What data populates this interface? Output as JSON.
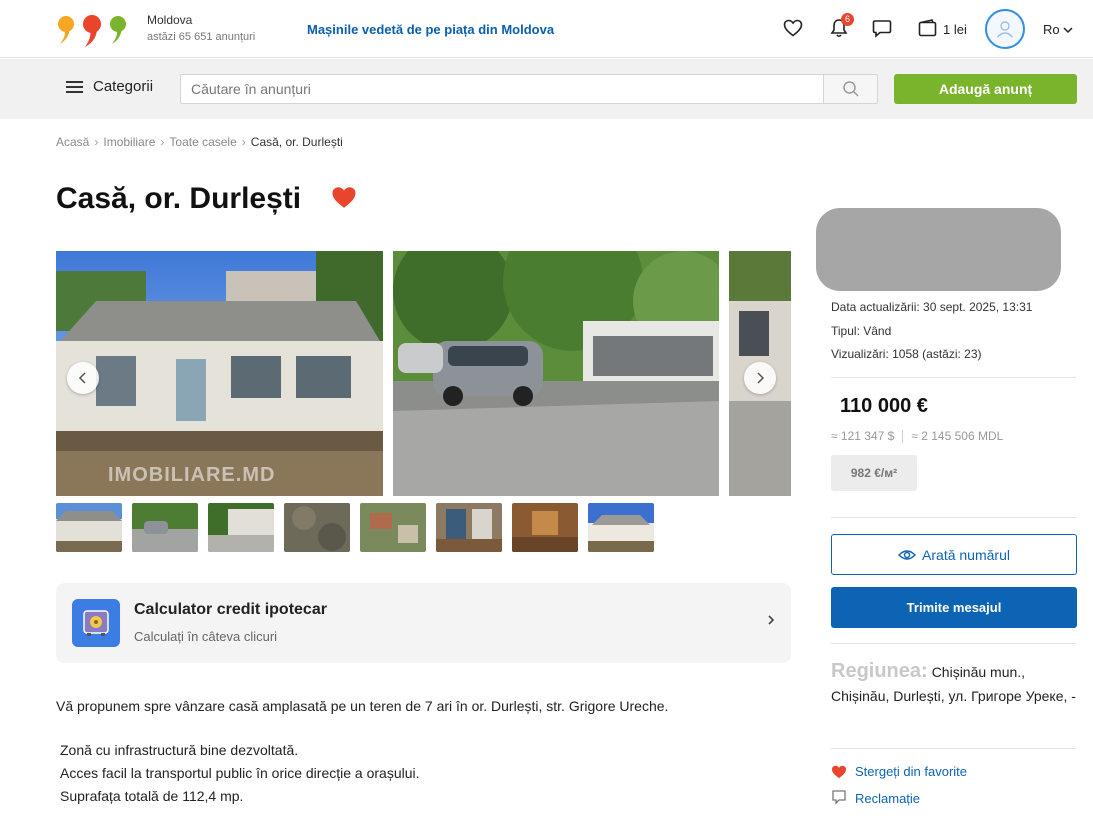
{
  "header": {
    "region": "Moldova",
    "ads_today": "astăzi 65 651 anunțuri",
    "promo_link": "Mașinile vedetă de pe piața din Moldova",
    "notifications_count": "6",
    "wallet": "1 lei",
    "language": "Ro"
  },
  "search": {
    "categories_label": "Categorii",
    "placeholder": "Căutare în anunțuri",
    "add_button": "Adaugă anunț"
  },
  "breadcrumb": [
    "Acasă",
    "Imobiliare",
    "Toate casele",
    "Casă, or. Durlești"
  ],
  "listing": {
    "title": "Casă, or. Durlești",
    "favorited": true,
    "photo_watermark": "IMOBILIARE.MD",
    "photo_count": 8
  },
  "calculator": {
    "title": "Calculator credit ipotecar",
    "subtitle": "Calculați în câteva clicuri"
  },
  "description": {
    "intro": "Vă propunem spre vânzare casă amplasată pe un teren de 7 ari în or. Durlești, str. Grigore Ureche.",
    "line1": "Zonă cu infrastructură bine dezvoltată.",
    "line2": "Acces facil la transportul public în orice direcție a orașului.",
    "line3": "Suprafața totală de 112,4 mp."
  },
  "sidebar": {
    "updated": "Data actualizării: 30 sept. 2025, 13:31",
    "type": "Tipul: Vând",
    "views": "Vizualizări: 1058 (astăzi: 23)",
    "price": "110 000 €",
    "price_usd": "≈ 121 347 $",
    "price_mdl": "≈ 2 145 506 MDL",
    "price_per_m2": "982 €/м²",
    "show_number": "Arată numărul",
    "send_message": "Trimite mesajul",
    "region_label": "Regiunea:",
    "region_value": "Chișinău mun., Chișinău, Durlești, ул. Григоре Уреке, -",
    "remove_favorite": "Stergeți din favorite",
    "report": "Reclamație"
  },
  "colors": {
    "brand_blue": "#0e64b4",
    "add_green": "#7ab42c",
    "heart_red": "#e8452c",
    "promo_blue": "#0a5eb0"
  }
}
